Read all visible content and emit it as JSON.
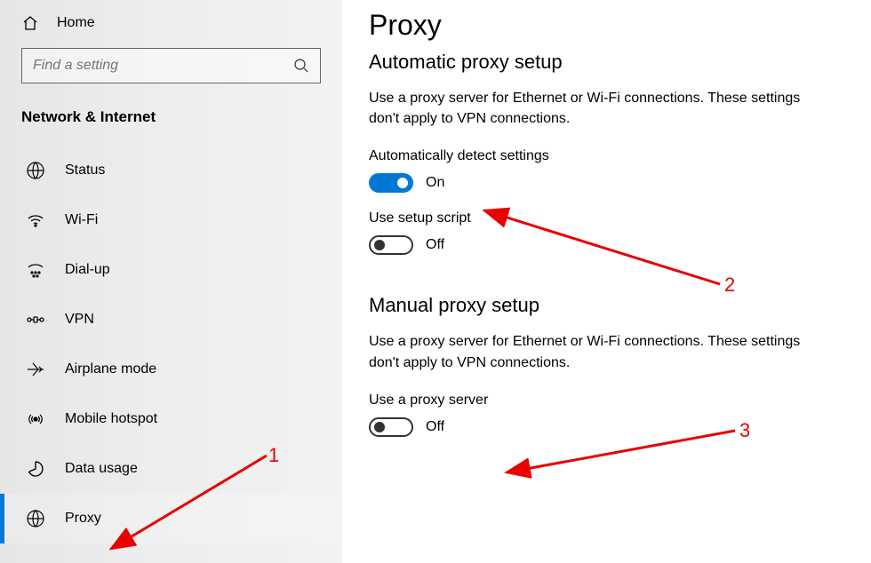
{
  "sidebar": {
    "home_label": "Home",
    "search_placeholder": "Find a setting",
    "category_label": "Network & Internet",
    "items": [
      {
        "label": "Status",
        "icon": "globe-net-icon"
      },
      {
        "label": "Wi-Fi",
        "icon": "wifi-icon"
      },
      {
        "label": "Dial-up",
        "icon": "dialup-icon"
      },
      {
        "label": "VPN",
        "icon": "vpn-icon"
      },
      {
        "label": "Airplane mode",
        "icon": "airplane-icon"
      },
      {
        "label": "Mobile hotspot",
        "icon": "hotspot-icon"
      },
      {
        "label": "Data usage",
        "icon": "data-usage-icon"
      },
      {
        "label": "Proxy",
        "icon": "proxy-globe-icon"
      }
    ],
    "active_index": 7
  },
  "main": {
    "title": "Proxy",
    "automatic": {
      "heading": "Automatic proxy setup",
      "description": "Use a proxy server for Ethernet or Wi-Fi connections. These settings don't apply to VPN connections.",
      "detect_label": "Automatically detect settings",
      "detect_state": "On",
      "detect_on": true,
      "script_label": "Use setup script",
      "script_state": "Off",
      "script_on": false
    },
    "manual": {
      "heading": "Manual proxy setup",
      "description": "Use a proxy server for Ethernet or Wi-Fi connections. These settings don't apply to VPN connections.",
      "use_proxy_label": "Use a proxy server",
      "use_proxy_state": "Off",
      "use_proxy_on": false
    }
  },
  "annotations": {
    "n1": "1",
    "n2": "2",
    "n3": "3"
  },
  "colors": {
    "accent": "#0078d4",
    "annotation": "#e90000"
  }
}
